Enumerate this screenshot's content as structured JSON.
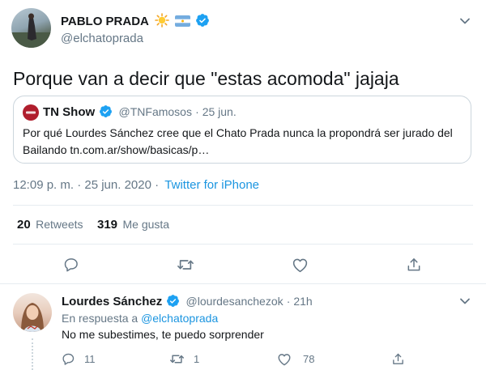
{
  "tweet": {
    "author_name": "PABLO PRADA",
    "author_handle": "@elchatoprada",
    "text": "Porque van a decir que \"estas acomoda\" jajaja",
    "quote": {
      "name": "TN Show",
      "handle": "@TNFamosos",
      "date": "· 25 jun.",
      "text": "Por qué Lourdes Sánchez cree que el Chato Prada nunca la propondrá ser jurado del Bailando tn.com.ar/show/basicas/p…"
    },
    "time": "12:09 p. m. · 25 jun. 2020 ·",
    "source": "Twitter for iPhone",
    "retweets_count": "20",
    "retweets_label": "Retweets",
    "likes_count": "319",
    "likes_label": "Me gusta"
  },
  "reply": {
    "author_name": "Lourdes Sánchez",
    "author_handle": "@lourdesanchezok",
    "time": "· 21h",
    "in_reply_prefix": "En respuesta a",
    "in_reply_handle": "@elchatoprada",
    "text": "No me subestimes, te puedo sorprender",
    "replies_count": "11",
    "retweets_count": "1",
    "likes_count": "78"
  },
  "colors": {
    "accent": "#1b95e0",
    "muted": "#657786",
    "border": "#e6ecf0",
    "verified": "#1da1f2"
  },
  "icons": [
    "sun-emoji-icon",
    "argentina-flag-icon",
    "verified-badge-icon",
    "chevron-down-icon",
    "reply-icon",
    "retweet-icon",
    "like-icon",
    "share-icon"
  ]
}
